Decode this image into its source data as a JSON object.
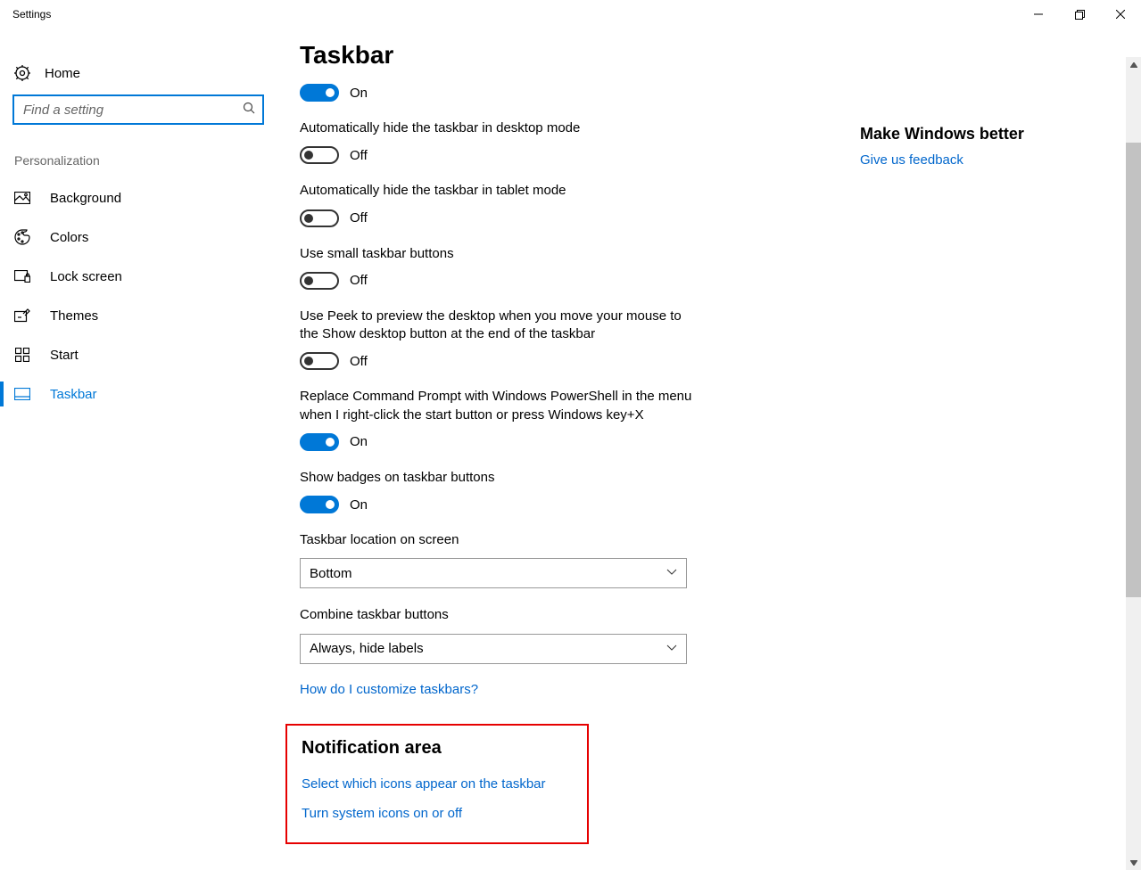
{
  "window": {
    "title": "Settings"
  },
  "sidebar": {
    "home": "Home",
    "search_placeholder": "Find a setting",
    "section": "Personalization",
    "items": [
      {
        "label": "Background"
      },
      {
        "label": "Colors"
      },
      {
        "label": "Lock screen"
      },
      {
        "label": "Themes"
      },
      {
        "label": "Start"
      },
      {
        "label": "Taskbar"
      }
    ]
  },
  "page": {
    "title": "Taskbar",
    "toggles": [
      {
        "label": "",
        "state": "On"
      },
      {
        "label": "Automatically hide the taskbar in desktop mode",
        "state": "Off"
      },
      {
        "label": "Automatically hide the taskbar in tablet mode",
        "state": "Off"
      },
      {
        "label": "Use small taskbar buttons",
        "state": "Off"
      },
      {
        "label": "Use Peek to preview the desktop when you move your mouse to the Show desktop button at the end of the taskbar",
        "state": "Off"
      },
      {
        "label": "Replace Command Prompt with Windows PowerShell in the menu when I right-click the start button or press Windows key+X",
        "state": "On"
      },
      {
        "label": "Show badges on taskbar buttons",
        "state": "On"
      }
    ],
    "dropdowns": {
      "location_label": "Taskbar location on screen",
      "location_value": "Bottom",
      "combine_label": "Combine taskbar buttons",
      "combine_value": "Always, hide labels"
    },
    "help_link": "How do I customize taskbars?",
    "notification": {
      "title": "Notification area",
      "link1": "Select which icons appear on the taskbar",
      "link2": "Turn system icons on or off"
    }
  },
  "aside": {
    "title": "Make Windows better",
    "feedback": "Give us feedback"
  }
}
